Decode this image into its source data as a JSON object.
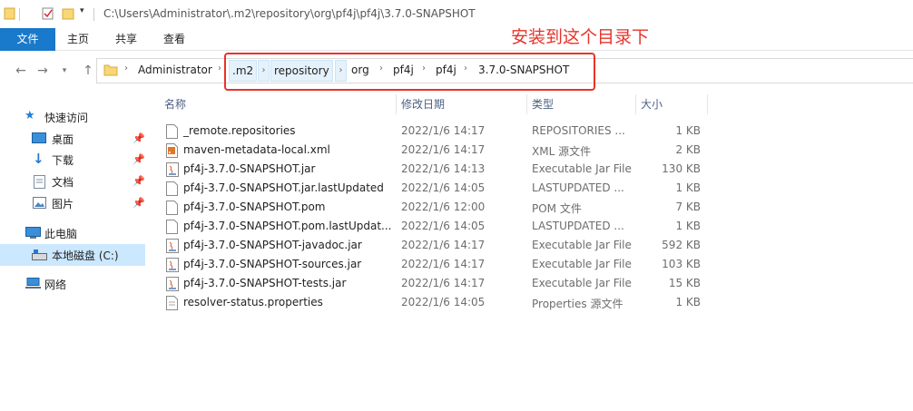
{
  "title": {
    "path": "C:\\Users\\Administrator\\.m2\\repository\\org\\pf4j\\pf4j\\3.7.0-SNAPSHOT"
  },
  "ribbon": {
    "tabs": [
      "文件",
      "主页",
      "共享",
      "查看"
    ]
  },
  "annotation": "安装到这个目录下",
  "address": {
    "crumbs": [
      "Administrator",
      ".m2",
      "repository",
      "org",
      "pf4j",
      "pf4j",
      "3.7.0-SNAPSHOT"
    ]
  },
  "nav": {
    "quick_access": "快速访问",
    "desktop": "桌面",
    "downloads": "下载",
    "documents": "文档",
    "pictures": "图片",
    "this_pc": "此电脑",
    "local_disk": "本地磁盘 (C:)",
    "network": "网络"
  },
  "columns": {
    "name": "名称",
    "date": "修改日期",
    "type": "类型",
    "size": "大小"
  },
  "files": [
    {
      "name": "_remote.repositories",
      "date": "2022/1/6 14:17",
      "type": "REPOSITORIES ...",
      "size": "1 KB",
      "icon": "doc-icon"
    },
    {
      "name": "maven-metadata-local.xml",
      "date": "2022/1/6 14:17",
      "type": "XML 源文件",
      "size": "2 KB",
      "icon": "xml-icon"
    },
    {
      "name": "pf4j-3.7.0-SNAPSHOT.jar",
      "date": "2022/1/6 14:13",
      "type": "Executable Jar File",
      "size": "130 KB",
      "icon": "jar-icon"
    },
    {
      "name": "pf4j-3.7.0-SNAPSHOT.jar.lastUpdated",
      "date": "2022/1/6 14:05",
      "type": "LASTUPDATED ...",
      "size": "1 KB",
      "icon": "doc-icon"
    },
    {
      "name": "pf4j-3.7.0-SNAPSHOT.pom",
      "date": "2022/1/6 12:00",
      "type": "POM 文件",
      "size": "7 KB",
      "icon": "doc-icon"
    },
    {
      "name": "pf4j-3.7.0-SNAPSHOT.pom.lastUpdat...",
      "date": "2022/1/6 14:05",
      "type": "LASTUPDATED ...",
      "size": "1 KB",
      "icon": "doc-icon"
    },
    {
      "name": "pf4j-3.7.0-SNAPSHOT-javadoc.jar",
      "date": "2022/1/6 14:17",
      "type": "Executable Jar File",
      "size": "592 KB",
      "icon": "jar-icon"
    },
    {
      "name": "pf4j-3.7.0-SNAPSHOT-sources.jar",
      "date": "2022/1/6 14:17",
      "type": "Executable Jar File",
      "size": "103 KB",
      "icon": "jar-icon"
    },
    {
      "name": "pf4j-3.7.0-SNAPSHOT-tests.jar",
      "date": "2022/1/6 14:17",
      "type": "Executable Jar File",
      "size": "15 KB",
      "icon": "jar-icon"
    },
    {
      "name": "resolver-status.properties",
      "date": "2022/1/6 14:05",
      "type": "Properties 源文件",
      "size": "1 KB",
      "icon": "properties-icon"
    }
  ]
}
